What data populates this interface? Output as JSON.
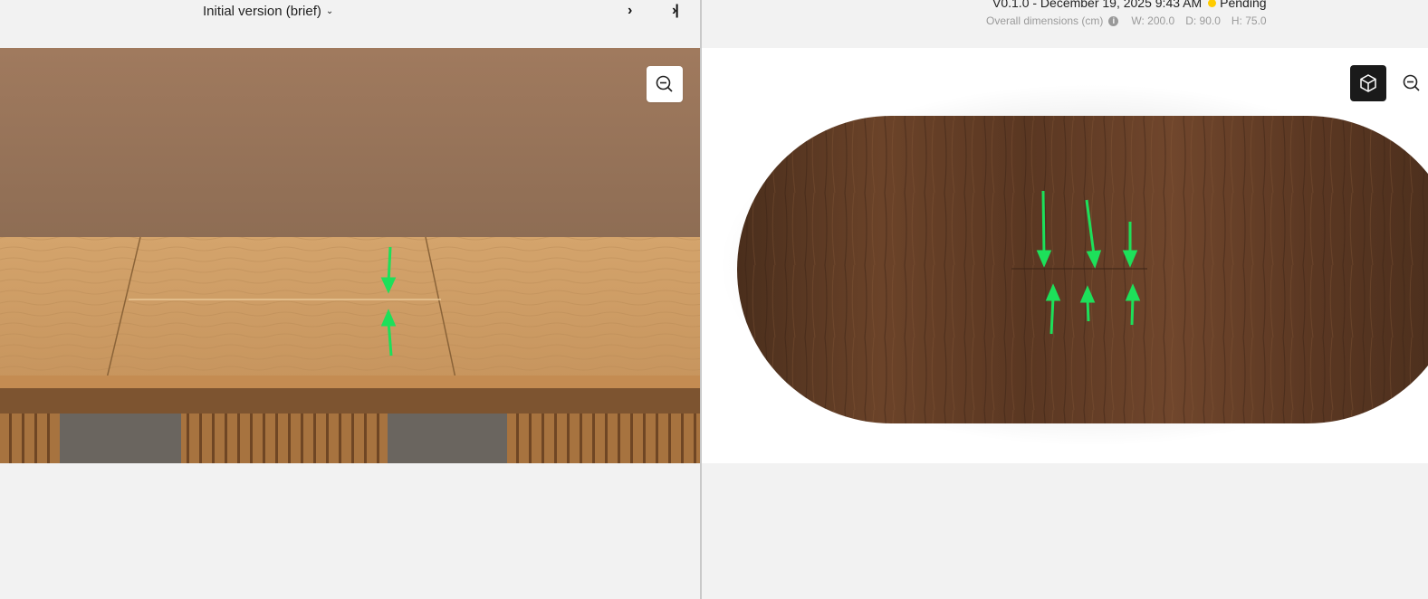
{
  "left_header": {
    "version_label": "Initial version (brief)"
  },
  "right_header": {
    "version_line": "V0.1.0 - December 19, 2025 9:43 AM",
    "status": "Pending",
    "dims_label": "Overall dimensions (cm)",
    "width": "W: 200.0",
    "depth": "D: 90.0",
    "height": "H: 75.0"
  },
  "icons": {
    "version_dropdown": "chevron-down-icon",
    "next": "chevron-right-icon",
    "last": "skip-to-end-icon",
    "zoom_left": "zoom-out-icon",
    "view_3d": "cube-icon",
    "zoom_right": "zoom-out-icon",
    "info": "info-icon"
  },
  "colors": {
    "status_pending": "#ffcc00",
    "annotation_arrow": "#1de05a",
    "cube_button_bg": "#1a1a1a"
  }
}
